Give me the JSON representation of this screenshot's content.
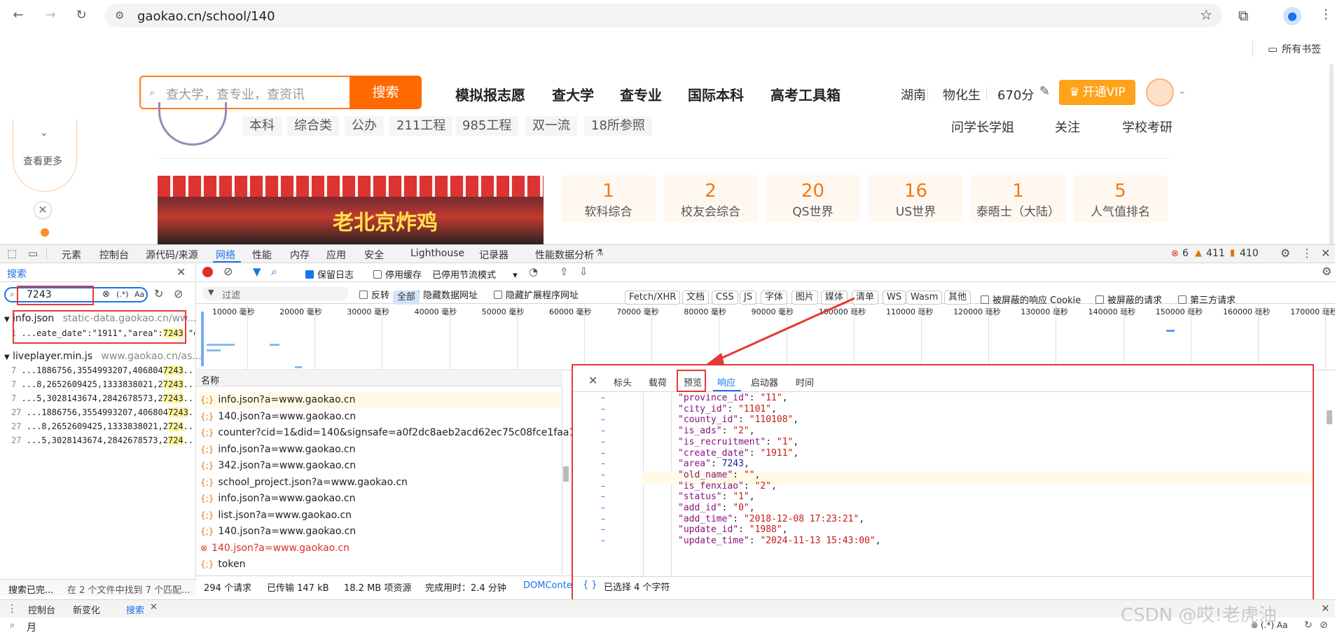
{
  "browser": {
    "url": "gaokao.cn/school/140",
    "bookmarks_label": "所有书签"
  },
  "site": {
    "search_placeholder": "查大学，查专业，查资讯",
    "search_button": "搜索",
    "nav": [
      "模拟报志愿",
      "查大学",
      "查专业",
      "国际本科",
      "高考工具箱"
    ],
    "province": "湖南",
    "subjects": "物化生",
    "score": "670分",
    "vip": "开通VIP",
    "left_more": "查看更多",
    "tags": [
      "本科",
      "综合类",
      "公办",
      "211工程",
      "985工程",
      "双一流",
      "18所参照"
    ],
    "right_links": [
      "问学长学姐",
      "关注",
      "学校考研"
    ],
    "stats": [
      {
        "num": "1",
        "label": "软科综合"
      },
      {
        "num": "2",
        "label": "校友会综合"
      },
      {
        "num": "20",
        "label": "QS世界"
      },
      {
        "num": "16",
        "label": "US世界"
      },
      {
        "num": "1",
        "label": "泰晤士（大陆）"
      },
      {
        "num": "5",
        "label": "人气值排名"
      }
    ],
    "banner_text": "老北京炸鸡"
  },
  "devtools": {
    "tabs": [
      "元素",
      "控制台",
      "源代码/来源",
      "网络",
      "性能",
      "内存",
      "应用",
      "安全",
      "Lighthouse",
      "记录器",
      "性能数据分析"
    ],
    "active_tab": "网络",
    "errors": "6",
    "warnings": "411",
    "info": "410",
    "search_title": "搜索",
    "search_query": "7243",
    "regex": "(.*)",
    "case": "Aa",
    "results": [
      {
        "file": "info.json",
        "url": "static-data.gaokao.cn/ww...",
        "lines": [
          {
            "n": "1",
            "text": "...eate_date\":\"1911\",\"area\":",
            "hit": "7243",
            "after": ",\"olc..."
          }
        ]
      },
      {
        "file": "liveplayer.min.js",
        "url": "www.gaokao.cn/as...",
        "lines": [
          {
            "n": "7",
            "text": "...1886756,3554993207,406804",
            "hit": "7243",
            "after": "..."
          },
          {
            "n": "7",
            "text": "...8,2652609425,1333838021,2",
            "hit": "7243",
            "after": "..."
          },
          {
            "n": "7",
            "text": "...5,3028143674,2842678573,2",
            "hit": "7243",
            "after": "..."
          },
          {
            "n": "27",
            "text": "...1886756,3554993207,406804",
            "hit": "7243",
            "after": "..."
          },
          {
            "n": "27",
            "text": "...8,2652609425,1333838021,2",
            "hit": "724",
            "after": "..."
          },
          {
            "n": "27",
            "text": "...5,3028143674,2842678573,2",
            "hit": "724",
            "after": "..."
          }
        ]
      }
    ],
    "search_status": "搜索已完...",
    "search_summary": "在 2 个文件中找到 7 个匹配...",
    "preserve_log": "保留日志",
    "disable_cache": "停用缓存",
    "throttle": "已停用节流模式",
    "filter_placeholder": "过滤",
    "invert": "反转",
    "hide_data": "隐藏数据网址",
    "hide_ext": "隐藏扩展程序网址",
    "type_chips": [
      "全部",
      "Fetch/XHR",
      "文档",
      "CSS",
      "JS",
      "字体",
      "图片",
      "媒体",
      "清单",
      "WS",
      "Wasm",
      "其他"
    ],
    "blocked_cookies": "被屏蔽的响应 Cookie",
    "blocked_requests": "被屏蔽的请求",
    "third_party": "第三方请求",
    "timeline_ticks": [
      "10000 毫秒",
      "20000 毫秒",
      "30000 毫秒",
      "40000 毫秒",
      "50000 毫秒",
      "60000 毫秒",
      "70000 毫秒",
      "80000 毫秒",
      "90000 毫秒",
      "100000 毫秒",
      "110000 毫秒",
      "120000 毫秒",
      "130000 毫秒",
      "140000 毫秒",
      "150000 毫秒",
      "160000 毫秒",
      "170000 毫秒"
    ],
    "name_header": "名称",
    "requests": [
      {
        "name": "info.json?a=www.gaokao.cn",
        "err": false
      },
      {
        "name": "140.json?a=www.gaokao.cn",
        "err": false
      },
      {
        "name": "counter?cid=1&did=140&signsafe=a0f2dc8aeb2acd62ec75c08fce1faa1f",
        "err": false
      },
      {
        "name": "info.json?a=www.gaokao.cn",
        "err": false
      },
      {
        "name": "342.json?a=www.gaokao.cn",
        "err": false
      },
      {
        "name": "school_project.json?a=www.gaokao.cn",
        "err": false
      },
      {
        "name": "info.json?a=www.gaokao.cn",
        "err": false
      },
      {
        "name": "list.json?a=www.gaokao.cn",
        "err": false
      },
      {
        "name": "140.json?a=www.gaokao.cn",
        "err": false
      },
      {
        "name": "140.json?a=www.gaokao.cn",
        "err": true
      },
      {
        "name": "token",
        "err": false
      }
    ],
    "status_bar": [
      "294 个请求",
      "已传输 147 kB",
      "18.2 MB 项资源",
      "完成用时：2.4 分钟",
      "DOMConte"
    ],
    "detail_tabs": [
      "标头",
      "载荷",
      "预览",
      "响应",
      "启动器",
      "时间"
    ],
    "active_detail_tab": "响应",
    "json_lines": [
      {
        "k": "\"province_id\"",
        "v": "\"11\"",
        "t": "s"
      },
      {
        "k": "\"city_id\"",
        "v": "\"1101\"",
        "t": "s"
      },
      {
        "k": "\"county_id\"",
        "v": "\"110108\"",
        "t": "s"
      },
      {
        "k": "\"is_ads\"",
        "v": "\"2\"",
        "t": "s"
      },
      {
        "k": "\"is_recruitment\"",
        "v": "\"1\"",
        "t": "s"
      },
      {
        "k": "\"create_date\"",
        "v": "\"1911\"",
        "t": "s"
      },
      {
        "k": "\"area\"",
        "v": "7243",
        "t": "n"
      },
      {
        "k": "\"old_name\"",
        "v": "\"\"",
        "t": "s"
      },
      {
        "k": "\"is_fenxiao\"",
        "v": "\"2\"",
        "t": "s"
      },
      {
        "k": "\"status\"",
        "v": "\"1\"",
        "t": "s"
      },
      {
        "k": "\"add_id\"",
        "v": "\"0\"",
        "t": "s"
      },
      {
        "k": "\"add_time\"",
        "v": "\"2018-12-08 17:23:21\"",
        "t": "s"
      },
      {
        "k": "\"update_id\"",
        "v": "\"1988\"",
        "t": "s"
      },
      {
        "k": "\"update_time\"",
        "v": "\"2024-11-13 15:43:00\"",
        "t": "s"
      }
    ],
    "selection": "已选择 4 个字符",
    "drawer_tabs": [
      "控制台",
      "新变化",
      "搜索"
    ],
    "drawer_input": "月",
    "watermark": "CSDN @哎!老虎油"
  }
}
